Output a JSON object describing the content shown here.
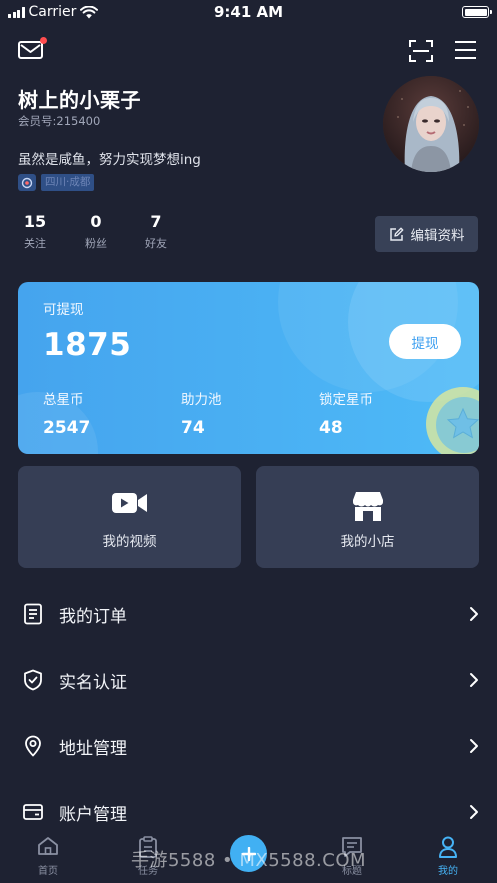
{
  "status_bar": {
    "carrier": "Carrier",
    "time": "9:41 AM"
  },
  "profile": {
    "username": "树上的小栗子",
    "member_id": "会员号:215400",
    "bio": "虽然是咸鱼，努力实现梦想ing",
    "location": "四川·成都"
  },
  "stats": [
    {
      "value": "15",
      "label": "关注"
    },
    {
      "value": "0",
      "label": "粉丝"
    },
    {
      "value": "7",
      "label": "好友"
    }
  ],
  "edit_button": {
    "label": "编辑资料"
  },
  "wallet": {
    "withdrawable_label": "可提现",
    "withdrawable_amount": "1875",
    "withdraw_button": "提现",
    "items": [
      {
        "label": "总星币",
        "value": "2547"
      },
      {
        "label": "助力池",
        "value": "74"
      },
      {
        "label": "锁定星币",
        "value": "48"
      }
    ]
  },
  "tiles": [
    {
      "label": "我的视频",
      "icon": "video-camera-icon"
    },
    {
      "label": "我的小店",
      "icon": "store-icon"
    }
  ],
  "menu": [
    {
      "label": "我的订单",
      "icon": "order-document-icon"
    },
    {
      "label": "实名认证",
      "icon": "shield-check-icon"
    },
    {
      "label": "地址管理",
      "icon": "location-pin-icon"
    },
    {
      "label": "账户管理",
      "icon": "wallet-card-icon"
    }
  ],
  "tab_bar": {
    "tabs": [
      {
        "label": "首页",
        "icon": "home-icon"
      },
      {
        "label": "任务",
        "icon": "clipboard-icon"
      },
      {
        "label": "标题",
        "icon": "message-icon"
      },
      {
        "label": "我的",
        "icon": "user-icon"
      }
    ],
    "active_index": 3
  },
  "watermark": "手游5588 • MX5588.COM",
  "colors": {
    "background": "#1e2232",
    "accent": "#46b3f5",
    "card_gradient_start": "#45a4ee",
    "card_gradient_end": "#4ebaf7",
    "tile_background": "#363e55",
    "badge": "#ff4d4f"
  }
}
